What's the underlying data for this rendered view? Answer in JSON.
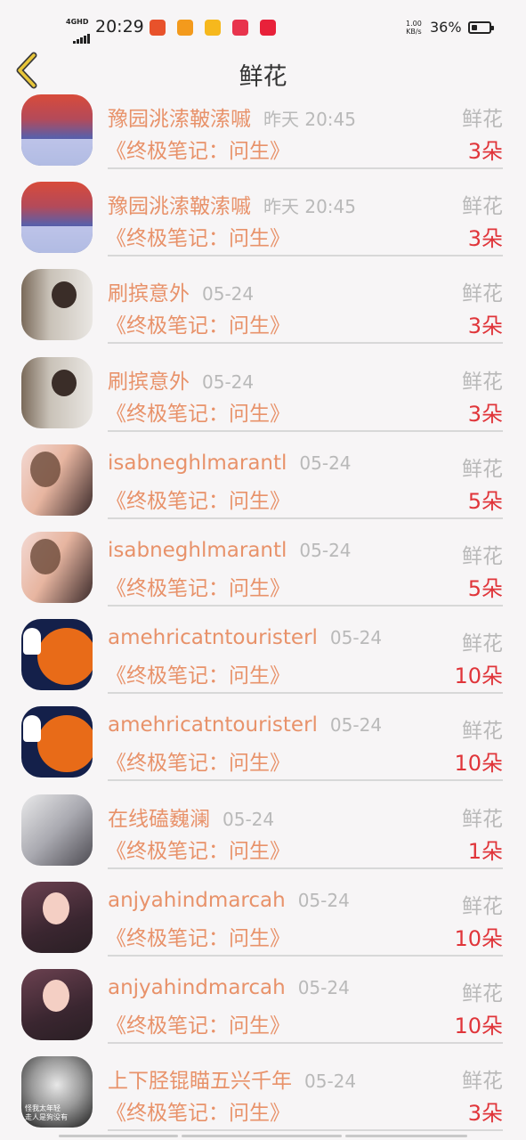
{
  "status_bar": {
    "network": "4GHD",
    "time": "20:29",
    "speed": "1.00",
    "speed_unit": "KB/s",
    "battery": "36%",
    "battery_level": 0.36,
    "apps": [
      {
        "icon": "news-app-icon",
        "color": "#e8522b"
      },
      {
        "icon": "camera-app-icon",
        "color": "#f39a1c"
      },
      {
        "icon": "panda-app-icon",
        "color": "#f6b81d"
      },
      {
        "icon": "heart-app-icon",
        "color": "#e8344d"
      },
      {
        "icon": "live-app-icon",
        "color": "#e8213a"
      }
    ]
  },
  "header": {
    "title": "鲜花",
    "back_icon": "chevron-left-icon",
    "accent": "#e8c63a"
  },
  "list": [
    {
      "name": "豫园洮溹鞁溹嘁",
      "time": "昨天 20:45",
      "book": "《终极笔记：问生》",
      "gift": "鲜花",
      "count": "3朵",
      "avatar": "night-landscape"
    },
    {
      "name": "豫园洮溹鞁溹嘁",
      "time": "昨天 20:45",
      "book": "《终极笔记：问生》",
      "gift": "鲜花",
      "count": "3朵",
      "avatar": "night-landscape"
    },
    {
      "name": "刷摈意外",
      "time": "05-24",
      "book": "《终极笔记：问生》",
      "gift": "鲜花",
      "count": "3朵",
      "avatar": "girl-in-room"
    },
    {
      "name": "刷摈意外",
      "time": "05-24",
      "book": "《终极笔记：问生》",
      "gift": "鲜花",
      "count": "3朵",
      "avatar": "girl-in-room"
    },
    {
      "name": "isabneghlmarantl",
      "time": "05-24",
      "book": "《终极笔记：问生》",
      "gift": "鲜花",
      "count": "5朵",
      "avatar": "two-girls"
    },
    {
      "name": "isabneghlmarantl",
      "time": "05-24",
      "book": "《终极笔记：问生》",
      "gift": "鲜花",
      "count": "5朵",
      "avatar": "two-girls"
    },
    {
      "name": "amehricatntouristerl",
      "time": "05-24",
      "book": "《终极笔记：问生》",
      "gift": "鲜花",
      "count": "10朵",
      "avatar": "pumpkin"
    },
    {
      "name": "amehricatntouristerl",
      "time": "05-24",
      "book": "《终极笔记：问生》",
      "gift": "鲜花",
      "count": "10朵",
      "avatar": "pumpkin"
    },
    {
      "name": "在线磕巍澜",
      "time": "05-24",
      "book": "《终极笔记：问生》",
      "gift": "鲜花",
      "count": "1朵",
      "avatar": "sketch-art"
    },
    {
      "name": "anjyahindmarcah",
      "time": "05-24",
      "book": "《终极笔记：问生》",
      "gift": "鲜花",
      "count": "10朵",
      "avatar": "anime-angel"
    },
    {
      "name": "anjyahindmarcah",
      "time": "05-24",
      "book": "《终极笔记：问生》",
      "gift": "鲜花",
      "count": "10朵",
      "avatar": "anime-angel"
    },
    {
      "name": "上下胫锟瞄五兴千年",
      "time": "05-24",
      "book": "《终极笔记：问生》",
      "gift": "鲜花",
      "count": "3朵",
      "avatar": "bw-portrait",
      "avatar_caption_1": "怪我太年轻",
      "avatar_caption_2": "走人是狗没有"
    }
  ],
  "colors": {
    "name": "#e8926a",
    "time": "#b9b9b9",
    "count": "#e0353a",
    "background": "#f7f5f6"
  }
}
